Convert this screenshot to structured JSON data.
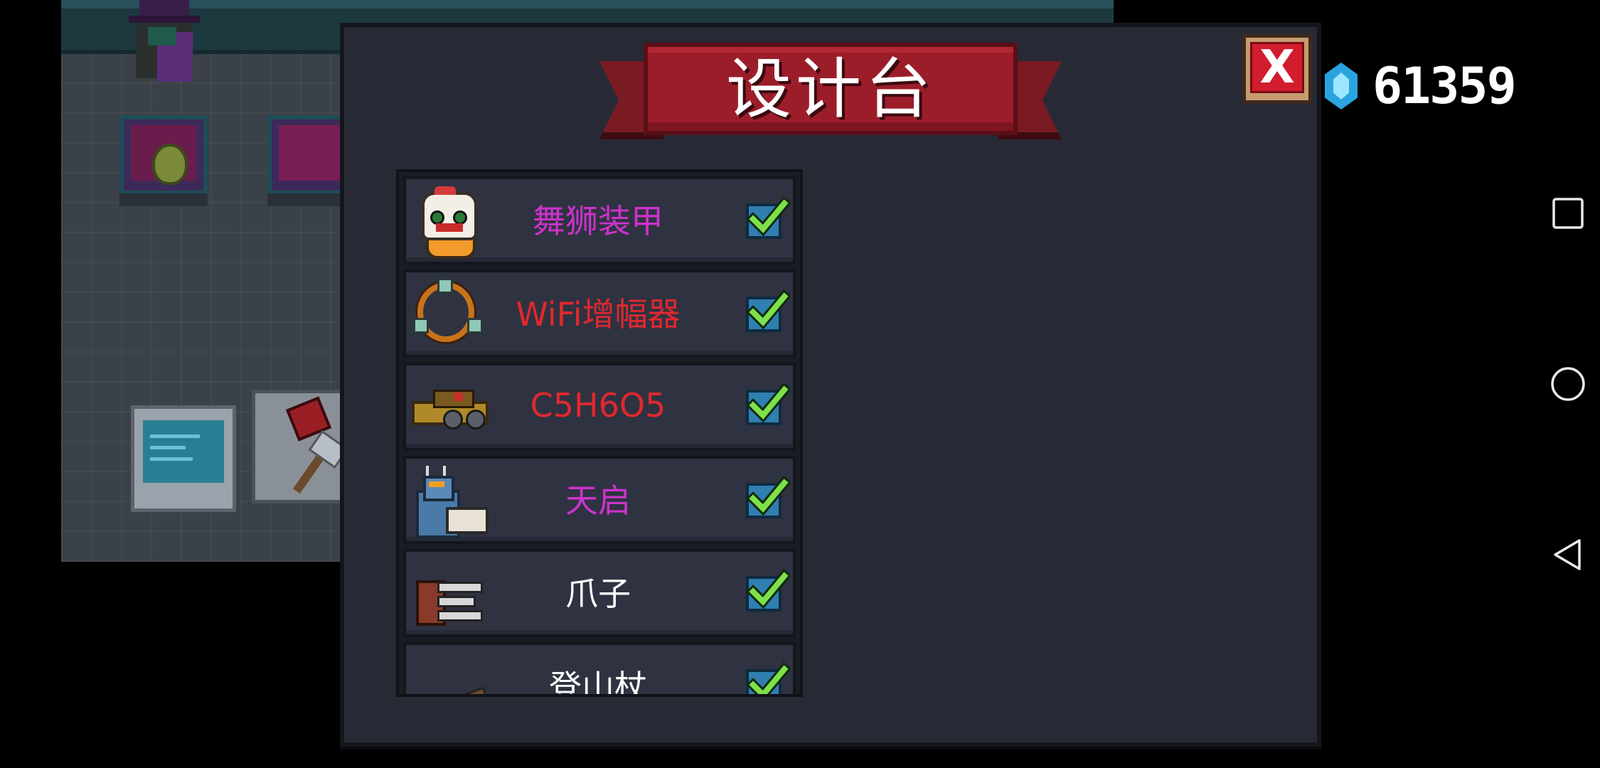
{
  "dialog": {
    "title": "设计台",
    "close_label": "X"
  },
  "currency": {
    "icon": "gem-icon",
    "amount": "61359",
    "gem_color": "#2aa4e0"
  },
  "items": [
    {
      "name": "舞狮装甲",
      "color": "#cc33cc",
      "icon": "lion-dance-armor-icon",
      "checked": true
    },
    {
      "name": "WiFi增幅器",
      "color": "#e0282e",
      "icon": "wifi-amplifier-ring-icon",
      "checked": true
    },
    {
      "name": "C5H6O5",
      "color": "#e0282e",
      "icon": "gun-icon",
      "checked": true
    },
    {
      "name": "天启",
      "color": "#cc33cc",
      "icon": "mech-icon",
      "checked": true
    },
    {
      "name": "爪子",
      "color": "#ffffff",
      "icon": "claw-icon",
      "checked": true
    },
    {
      "name": "登山杖",
      "color": "#ffffff",
      "icon": "hiking-staff-icon",
      "checked": true
    }
  ],
  "nav": {
    "recent": "square-icon",
    "home": "circle-icon",
    "back": "triangle-back-icon"
  },
  "colors": {
    "dialog_bg": "#272a35",
    "banner": "#9c1d2a",
    "check_green": "#7ee04a",
    "check_box": "#2f7fb0"
  }
}
